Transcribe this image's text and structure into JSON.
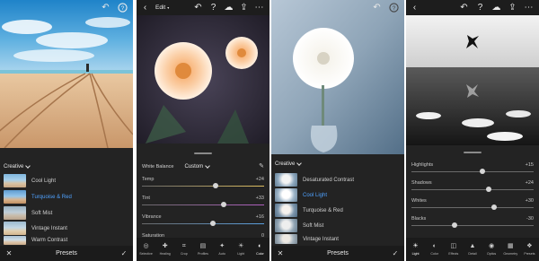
{
  "panel1": {
    "section_title": "Creative",
    "presets": [
      {
        "label": "Cool Light",
        "selected": false
      },
      {
        "label": "Turquoise & Red",
        "selected": true
      },
      {
        "label": "Soft Mist",
        "selected": false
      },
      {
        "label": "Vintage Instant",
        "selected": false
      },
      {
        "label": "Warm Contrast",
        "selected": false
      }
    ],
    "bottom_title": "Presets",
    "cancel_icon": "close-icon",
    "confirm_icon": "check-icon"
  },
  "panel2": {
    "menu_label": "Edit",
    "white_balance_label": "White Balance",
    "white_balance_value": "Custom",
    "sliders": [
      {
        "label": "Temp",
        "value": "+24",
        "position": 0.6,
        "accent": "#e0c060"
      },
      {
        "label": "Tint",
        "value": "+33",
        "position": 0.67,
        "accent": "#b060c0"
      },
      {
        "label": "Vibrance",
        "value": "+16",
        "position": 0.58,
        "accent": "#5aa0e0"
      },
      {
        "label": "Saturation",
        "value": "0",
        "position": 0.5,
        "accent": "#d04040"
      }
    ],
    "tools": [
      {
        "label": "Selective",
        "icon": "selective-icon",
        "active": false
      },
      {
        "label": "Healing",
        "icon": "healing-icon",
        "active": false
      },
      {
        "label": "Crop",
        "icon": "crop-icon",
        "active": false
      },
      {
        "label": "Profiles",
        "icon": "profiles-icon",
        "active": false
      },
      {
        "label": "Auto",
        "icon": "auto-icon",
        "active": false
      },
      {
        "label": "Light",
        "icon": "light-icon",
        "active": false
      },
      {
        "label": "Color",
        "icon": "color-icon",
        "active": true
      }
    ]
  },
  "panel3": {
    "section_title": "Creative",
    "presets": [
      {
        "label": "Desaturated Contrast",
        "selected": false
      },
      {
        "label": "Cool Light",
        "selected": true
      },
      {
        "label": "Turquoise & Red",
        "selected": false
      },
      {
        "label": "Soft Mist",
        "selected": false
      },
      {
        "label": "Vintage Instant",
        "selected": false
      }
    ],
    "bottom_title": "Presets"
  },
  "panel4": {
    "sliders": [
      {
        "label": "Highlights",
        "value": "+15",
        "position": 0.58
      },
      {
        "label": "Shadows",
        "value": "+24",
        "position": 0.63
      },
      {
        "label": "Whites",
        "value": "+30",
        "position": 0.68
      },
      {
        "label": "Blacks",
        "value": "-30",
        "position": 0.35
      }
    ],
    "tools": [
      {
        "label": "Light",
        "icon": "light-icon",
        "active": true
      },
      {
        "label": "Color",
        "icon": "color-icon",
        "active": false
      },
      {
        "label": "Effects",
        "icon": "effects-icon",
        "active": false
      },
      {
        "label": "Detail",
        "icon": "detail-icon",
        "active": false
      },
      {
        "label": "Optics",
        "icon": "optics-icon",
        "active": false
      },
      {
        "label": "Geometry",
        "icon": "geometry-icon",
        "active": false
      },
      {
        "label": "Presets",
        "icon": "presets-icon",
        "active": false
      }
    ]
  },
  "colors": {
    "panel_bg": "#232323",
    "bar_bg": "#1b1b1b",
    "selected_preset": "#4fa2ff"
  }
}
